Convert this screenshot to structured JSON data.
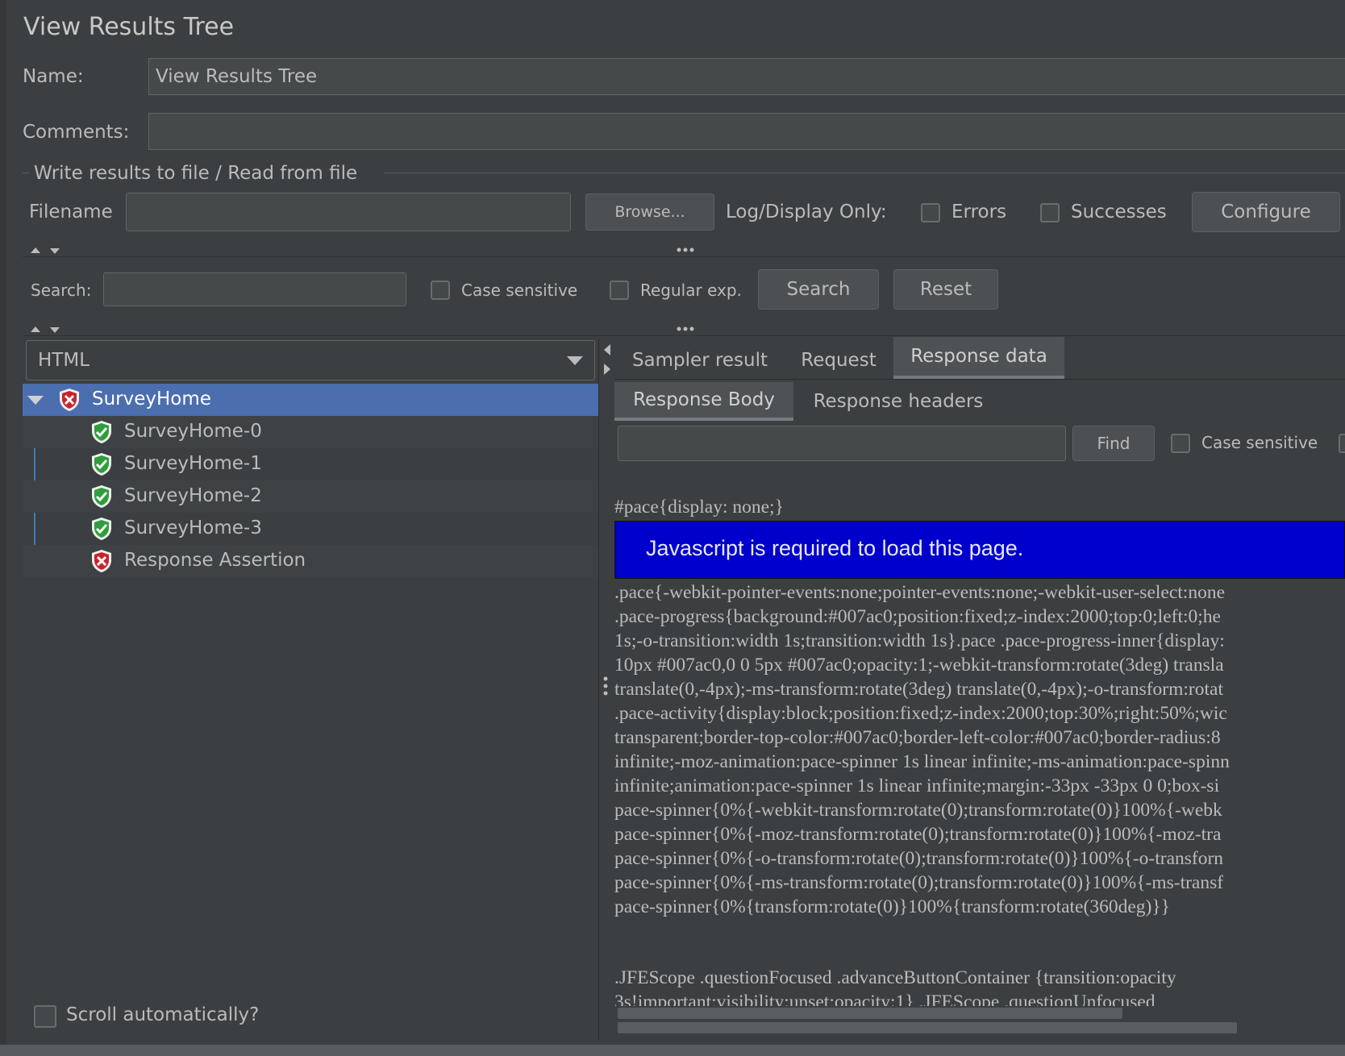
{
  "panel": {
    "title": "View Results Tree",
    "name_label": "Name:",
    "name_value": "View Results Tree",
    "comments_label": "Comments:",
    "comments_value": ""
  },
  "file_section": {
    "legend": "Write results to file / Read from file",
    "filename_label": "Filename",
    "filename_value": "",
    "browse_label": "Browse...",
    "log_display_label": "Log/Display Only:",
    "errors_label": "Errors",
    "errors_checked": false,
    "successes_label": "Successes",
    "successes_checked": false,
    "configure_label": "Configure"
  },
  "search": {
    "label": "Search:",
    "value": "",
    "case_sensitive_label": "Case sensitive",
    "case_sensitive_checked": false,
    "regex_label": "Regular exp.",
    "regex_checked": false,
    "search_button": "Search",
    "reset_button": "Reset"
  },
  "renderer_select": {
    "selected": "HTML"
  },
  "tree": {
    "items": [
      {
        "label": "SurveyHome",
        "status": "error",
        "selected": true,
        "expanded": true
      },
      {
        "label": "SurveyHome-0",
        "status": "success"
      },
      {
        "label": "SurveyHome-1",
        "status": "success"
      },
      {
        "label": "SurveyHome-2",
        "status": "success"
      },
      {
        "label": "SurveyHome-3",
        "status": "success"
      },
      {
        "label": "Response Assertion",
        "status": "error"
      }
    ]
  },
  "scroll_auto": {
    "label": "Scroll automatically?",
    "checked": false
  },
  "result_tabs": [
    {
      "label": "Sampler result",
      "active": false
    },
    {
      "label": "Request",
      "active": false
    },
    {
      "label": "Response data",
      "active": true
    }
  ],
  "response_tabs": [
    {
      "label": "Response Body",
      "active": true
    },
    {
      "label": "Response headers",
      "active": false
    }
  ],
  "find_bar": {
    "value": "",
    "find_button": "Find",
    "case_sensitive_label": "Case sensitive",
    "case_sensitive_checked": false
  },
  "response_body": {
    "pace_line": "#pace{display: none;}",
    "js_banner": "Javascript is required to load this page.",
    "css_lines": [
      ".pace{-webkit-pointer-events:none;pointer-events:none;-webkit-user-select:none",
      " .pace-progress{background:#007ac0;position:fixed;z-index:2000;top:0;left:0;he",
      "1s;-o-transition:width 1s;transition:width 1s}.pace .pace-progress-inner{display:",
      "10px #007ac0,0 0 5px #007ac0;opacity:1;-webkit-transform:rotate(3deg) transla",
      "translate(0,-4px);-ms-transform:rotate(3deg) translate(0,-4px);-o-transform:rotat",
      ".pace-activity{display:block;position:fixed;z-index:2000;top:30%;right:50%;wic",
      "transparent;border-top-color:#007ac0;border-left-color:#007ac0;border-radius:8",
      "infinite;-moz-animation:pace-spinner 1s linear infinite;-ms-animation:pace-spinn",
      "infinite;animation:pace-spinner 1s linear infinite;margin:-33px -33px 0 0;box-si",
      "pace-spinner{0%{-webkit-transform:rotate(0);transform:rotate(0)}100%{-webk",
      " pace-spinner{0%{-moz-transform:rotate(0);transform:rotate(0)}100%{-moz-tra",
      "pace-spinner{0%{-o-transform:rotate(0);transform:rotate(0)}100%{-o-transforn",
      "pace-spinner{0%{-ms-transform:rotate(0);transform:rotate(0)}100%{-ms-transf",
      "pace-spinner{0%{transform:rotate(0)}100%{transform:rotate(360deg)}}"
    ],
    "tail_lines": [
      ".JFEScope .questionFocused .advanceButtonContainer {transition:opacity",
      " 3s!important;visibility:unset;opacity:1} .JFEScope .questionUnfocused"
    ]
  },
  "colors": {
    "background": "#3c3f41",
    "selection": "#4b6eaf",
    "js_banner_bg": "#0000cc",
    "success_icon": "#2e9e3a",
    "error_icon": "#c8242b"
  }
}
